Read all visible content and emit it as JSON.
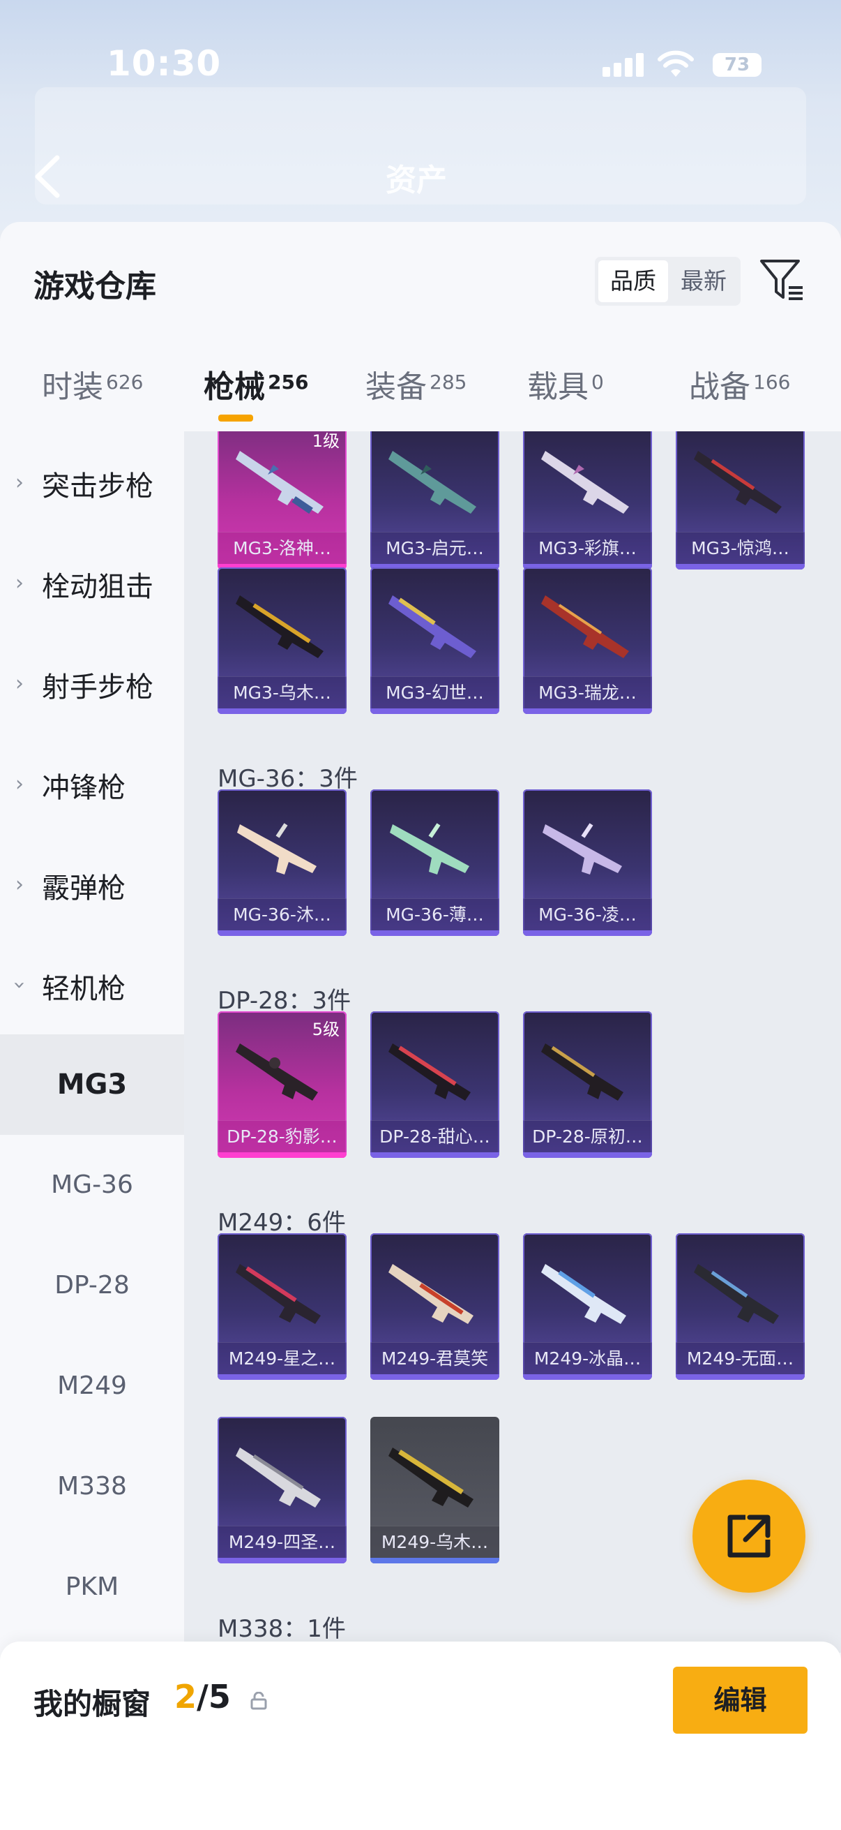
{
  "status_bar": {
    "time": "10:30",
    "battery": "73"
  },
  "header": {
    "title": "资产"
  },
  "sheet": {
    "title": "游戏仓库",
    "sort_options": [
      "品质",
      "最新"
    ],
    "tabs": [
      {
        "label": "时装",
        "count": "626"
      },
      {
        "label": "枪械",
        "count": "256"
      },
      {
        "label": "装备",
        "count": "285"
      },
      {
        "label": "载具",
        "count": "0"
      },
      {
        "label": "战备",
        "count": "166"
      }
    ]
  },
  "sidebar": {
    "categories": [
      "突击步枪",
      "栓动狙击",
      "射手步枪",
      "冲锋枪",
      "霰弹枪",
      "轻机枪"
    ],
    "sub_items": [
      "MG3",
      "MG-36",
      "DP-28",
      "M249",
      "M338",
      "PKM"
    ]
  },
  "groups": {
    "mg3": {
      "items": [
        "MG3-洛神…",
        "MG3-启元…",
        "MG3-彩旗…",
        "MG3-惊鸿…",
        "MG3-乌木…",
        "MG3-幻世…",
        "MG3-瑞龙…"
      ],
      "first_level": "1级"
    },
    "mg36": {
      "title": "MG-36：3件",
      "items": [
        "MG-36-沐…",
        "MG-36-薄…",
        "MG-36-凌…"
      ]
    },
    "dp28": {
      "title": "DP-28：3件",
      "items": [
        "DP-28-豹影…",
        "DP-28-甜心…",
        "DP-28-原初…"
      ],
      "first_level": "5级"
    },
    "m249": {
      "title": "M249：6件",
      "items": [
        "M249-星之…",
        "M249-君莫笑",
        "M249-冰晶…",
        "M249-无面…",
        "M249-四圣…",
        "M249-乌木…"
      ]
    },
    "m338": {
      "title": "M338：1件"
    }
  },
  "bottom": {
    "label": "我的橱窗",
    "current": "2",
    "total": "/5",
    "edit": "编辑"
  },
  "colors": {
    "accent": "#f8ad12",
    "epic": "#6f5fd0",
    "legendary": "#d23ab4"
  }
}
